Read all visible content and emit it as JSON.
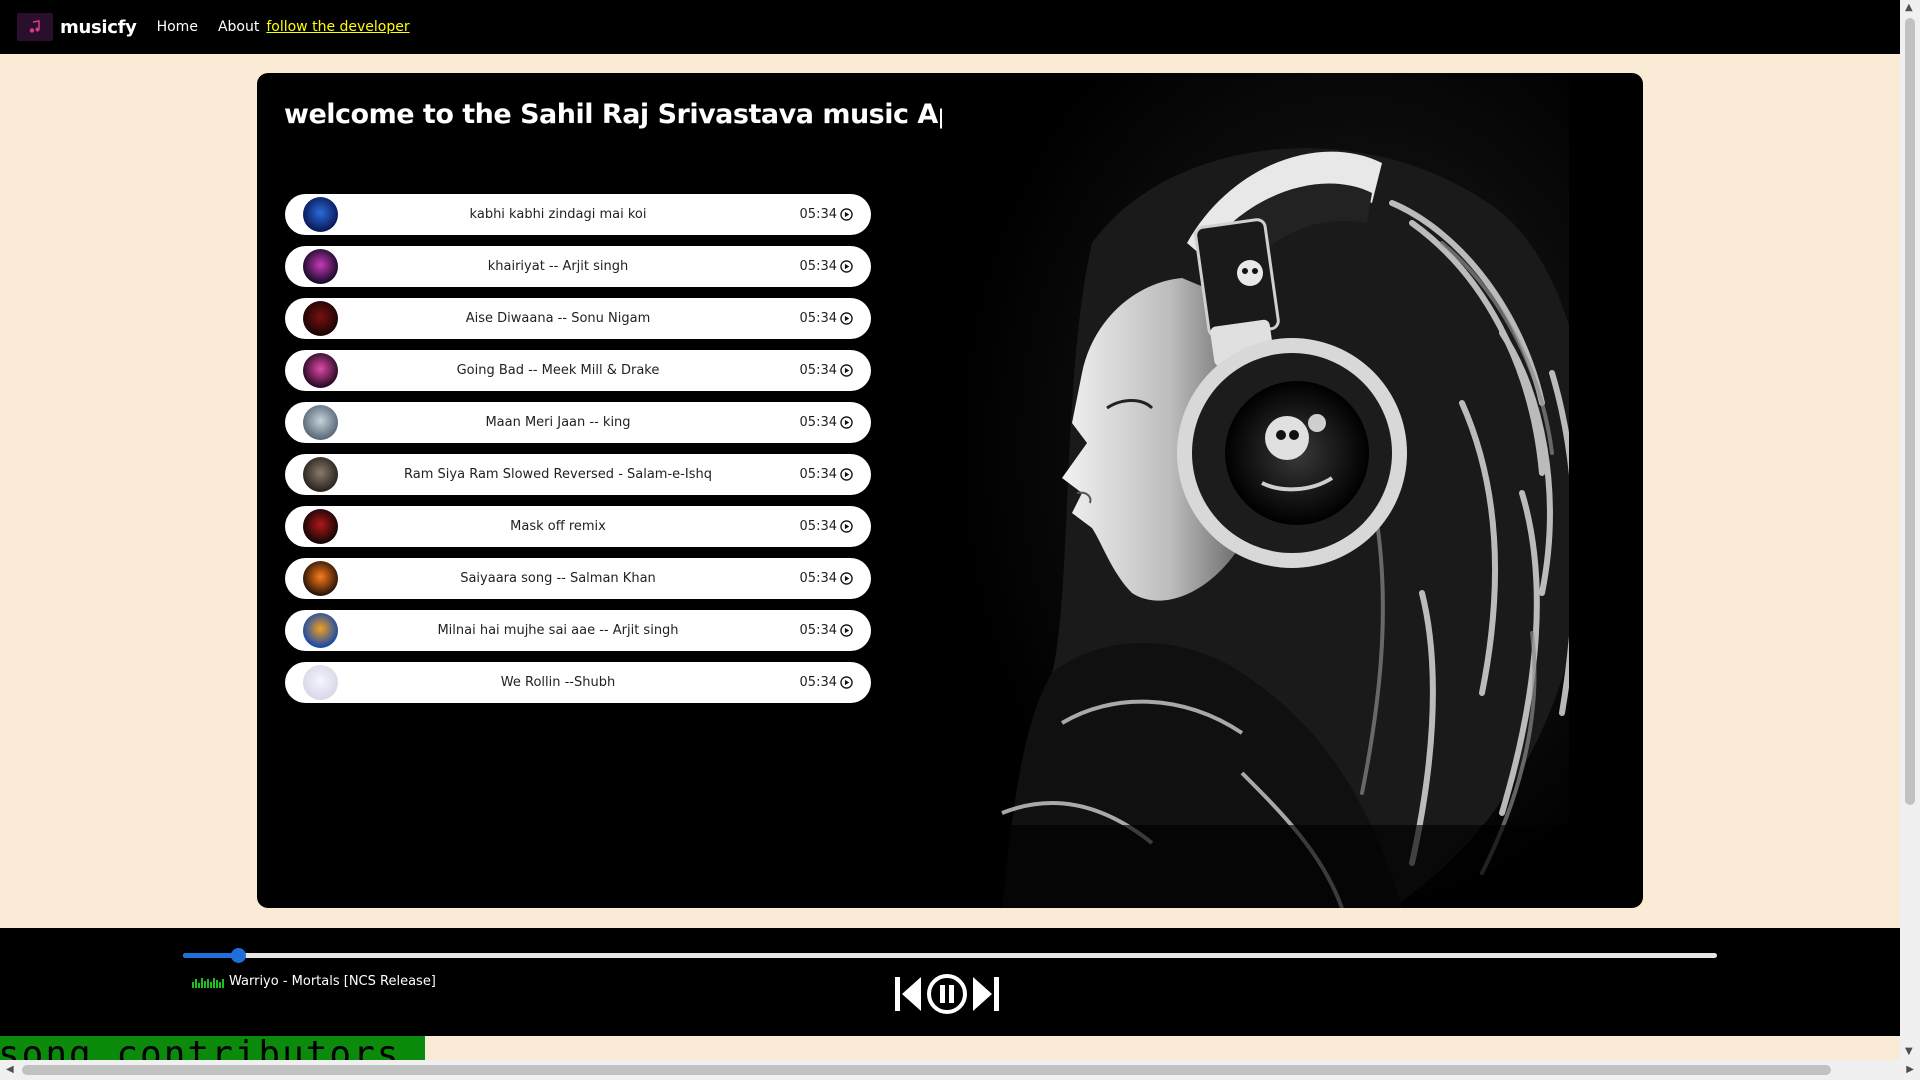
{
  "navbar": {
    "brand": "musicfy",
    "links": [
      "Home",
      "About"
    ],
    "developer_link": "follow the developer",
    "logo_icon": "music-note-icon"
  },
  "main": {
    "title": "welcome to the Sahil Raj Srivastava music App",
    "songs": [
      {
        "name": "kabhi kabhi zindagi mai koi",
        "duration": "05:34",
        "cover_colors": [
          "#0a1a5a",
          "#2a6ad8"
        ]
      },
      {
        "name": "khairiyat -- Arjit singh",
        "duration": "05:34",
        "cover_colors": [
          "#1a0a2a",
          "#c63ab8"
        ]
      },
      {
        "name": "Aise Diwaana -- Sonu Nigam",
        "duration": "05:34",
        "cover_colors": [
          "#1a0505",
          "#7a1010"
        ]
      },
      {
        "name": "Going Bad -- Meek Mill & Drake",
        "duration": "05:34",
        "cover_colors": [
          "#2a0a25",
          "#e04aa8"
        ]
      },
      {
        "name": "Maan Meri Jaan -- king",
        "duration": "05:34",
        "cover_colors": [
          "#5a6a7a",
          "#c8d2dc"
        ]
      },
      {
        "name": "Ram Siya Ram Slowed Reversed - Salam-e-Ishq",
        "duration": "05:34",
        "cover_colors": [
          "#2a2520",
          "#8a7a6a"
        ]
      },
      {
        "name": "Mask off remix",
        "duration": "05:34",
        "cover_colors": [
          "#150505",
          "#b01818"
        ]
      },
      {
        "name": "Saiyaara song -- Salman Khan",
        "duration": "05:34",
        "cover_colors": [
          "#2a1508",
          "#ff7a1a"
        ]
      },
      {
        "name": "Milnai hai mujhe sai aae -- Arjit singh",
        "duration": "05:34",
        "cover_colors": [
          "#1a4aa8",
          "#f0a020"
        ]
      },
      {
        "name": "We Rollin --Shubh",
        "duration": "05:34",
        "cover_colors": [
          "#d8d8e8",
          "#f5f5ff"
        ]
      }
    ],
    "play_icon": "play-circle-icon",
    "image": "woman-with-headphones-photo"
  },
  "player": {
    "progress_fraction": 0.036,
    "now_playing": "Warriyo - Mortals [NCS Release]",
    "equalizer_icon": "equalizer-icon",
    "controls": [
      "previous-icon",
      "pause-circle-icon",
      "next-icon"
    ],
    "accent_color": "#1e6fd9"
  },
  "contributors": {
    "text": "song contributors"
  },
  "colors": {
    "page_bg": "#faebd7",
    "nav_bg": "#000000",
    "link_highlight": "#ffff00",
    "contrib_bg": "#0b8a0b"
  }
}
